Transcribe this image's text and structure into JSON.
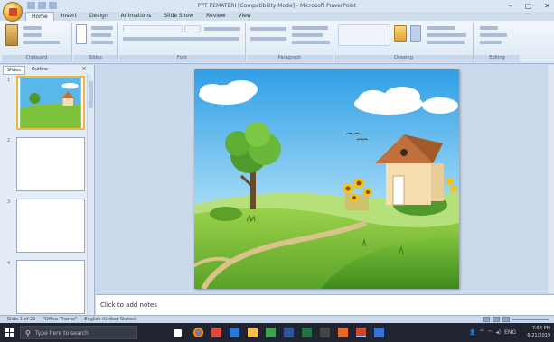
{
  "window": {
    "title": "PPT PEMATERI [Compatibility Mode] - Microsoft PowerPoint",
    "controls": [
      "–",
      "▢",
      "✕"
    ]
  },
  "ribbon": {
    "tabs": [
      "Home",
      "Insert",
      "Design",
      "Animations",
      "Slide Show",
      "Review",
      "View"
    ],
    "active_tab": "Home",
    "groups": [
      "Clipboard",
      "Slides",
      "Font",
      "Paragraph",
      "Drawing",
      "Editing"
    ],
    "buttons": {
      "cut": "Cut",
      "copy": "Copy",
      "format_painter": "Format Painter",
      "paste": "Paste",
      "new_slide": "New Slide",
      "layout": "Layout",
      "reset": "Reset",
      "delete": "Delete",
      "text_direction": "Text Direction",
      "align_text": "Align Text",
      "convert_smartart": "Convert to SmartArt",
      "arrange": "Arrange",
      "quick_styles": "Quick Styles",
      "shape_fill": "Shape Fill",
      "shape_outline": "Shape Outline",
      "shape_effects": "Shape Effects",
      "find": "Find",
      "replace": "Replace",
      "select": "Select"
    }
  },
  "left_pane": {
    "tabs": [
      "Slides",
      "Outline"
    ],
    "active_tab": "Slides",
    "close": "×",
    "slide_numbers": [
      "1",
      "2",
      "3",
      "4"
    ]
  },
  "notes": {
    "placeholder": "Click to add notes"
  },
  "statusbar": {
    "slide_info": "Slide 1 of 22",
    "theme": "\"Office Theme\"",
    "language": "English (United States)"
  },
  "taskbar": {
    "search_placeholder": "Type here to search",
    "time": "7:54 PM",
    "date": "6/21/2019",
    "lang": "ENG"
  },
  "colors": {
    "sky_top": "#3fa6e6",
    "grass": "#7cc23a",
    "roof": "#c0703a",
    "wall": "#f5deb0",
    "selected_border": "#f3b740",
    "taskbar": "#1f2430"
  }
}
